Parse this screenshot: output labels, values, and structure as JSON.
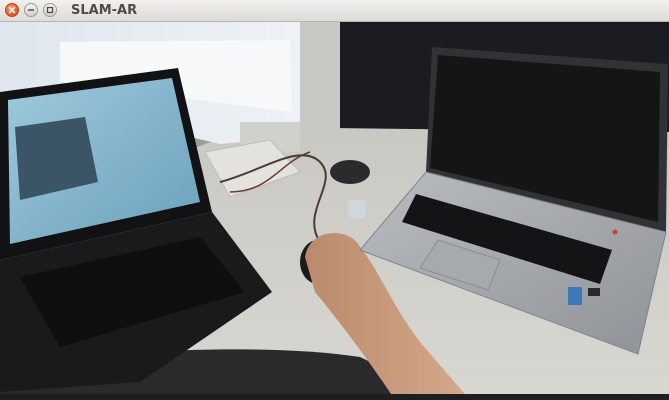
{
  "window": {
    "title": "SLAM-AR",
    "controls": {
      "close_icon": "close-icon",
      "minimize_icon": "minimize-icon",
      "maximize_icon": "maximize-icon"
    }
  },
  "viewport": {
    "description_icon": "camera-feed",
    "ar_overlay": "virtual-laptop-model"
  },
  "colors": {
    "titlebar": "#dedcd8",
    "close_button": "#e2531c",
    "title_text": "#4c4c4c"
  }
}
